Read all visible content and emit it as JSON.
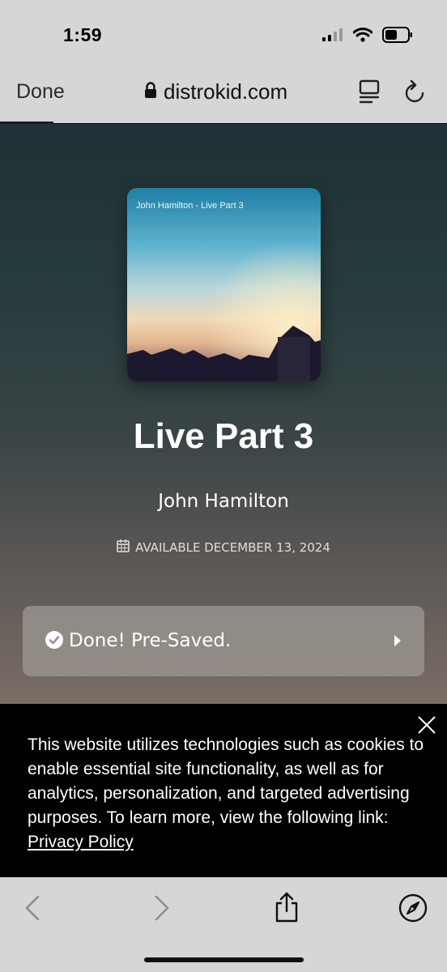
{
  "status_bar": {
    "time": "1:59",
    "icons": [
      "cellular-signal-icon",
      "wifi-icon",
      "battery-icon"
    ]
  },
  "browser": {
    "done_label": "Done",
    "url": "distrokid.com",
    "icons": [
      "lock-icon",
      "reader-mode-icon",
      "reload-icon"
    ]
  },
  "release": {
    "art_caption": "John Hamilton - Live Part 3",
    "title": "Live Part 3",
    "artist": "John Hamilton",
    "availability": "AVAILABLE DECEMBER 13, 2024"
  },
  "presave": {
    "label": "Done! Pre-Saved.",
    "icons": [
      "check-circle-icon",
      "caret-right-icon"
    ]
  },
  "cookie_banner": {
    "text": "This website utilizes technologies such as cookies to enable essential site functionality, as well as for analytics, personalization, and targeted advertising purposes. To learn more, view the following link: ",
    "link_label": "Privacy Policy"
  },
  "toolbar": {
    "icons": [
      "back-icon",
      "forward-icon",
      "share-icon",
      "compass-icon"
    ]
  },
  "colors": {
    "browser_chrome": "#d6d6d6",
    "page_top": "#1e3237",
    "page_bottom": "#7a6d65",
    "presave_bg": "#96918c",
    "cookie_bg": "#000000"
  }
}
